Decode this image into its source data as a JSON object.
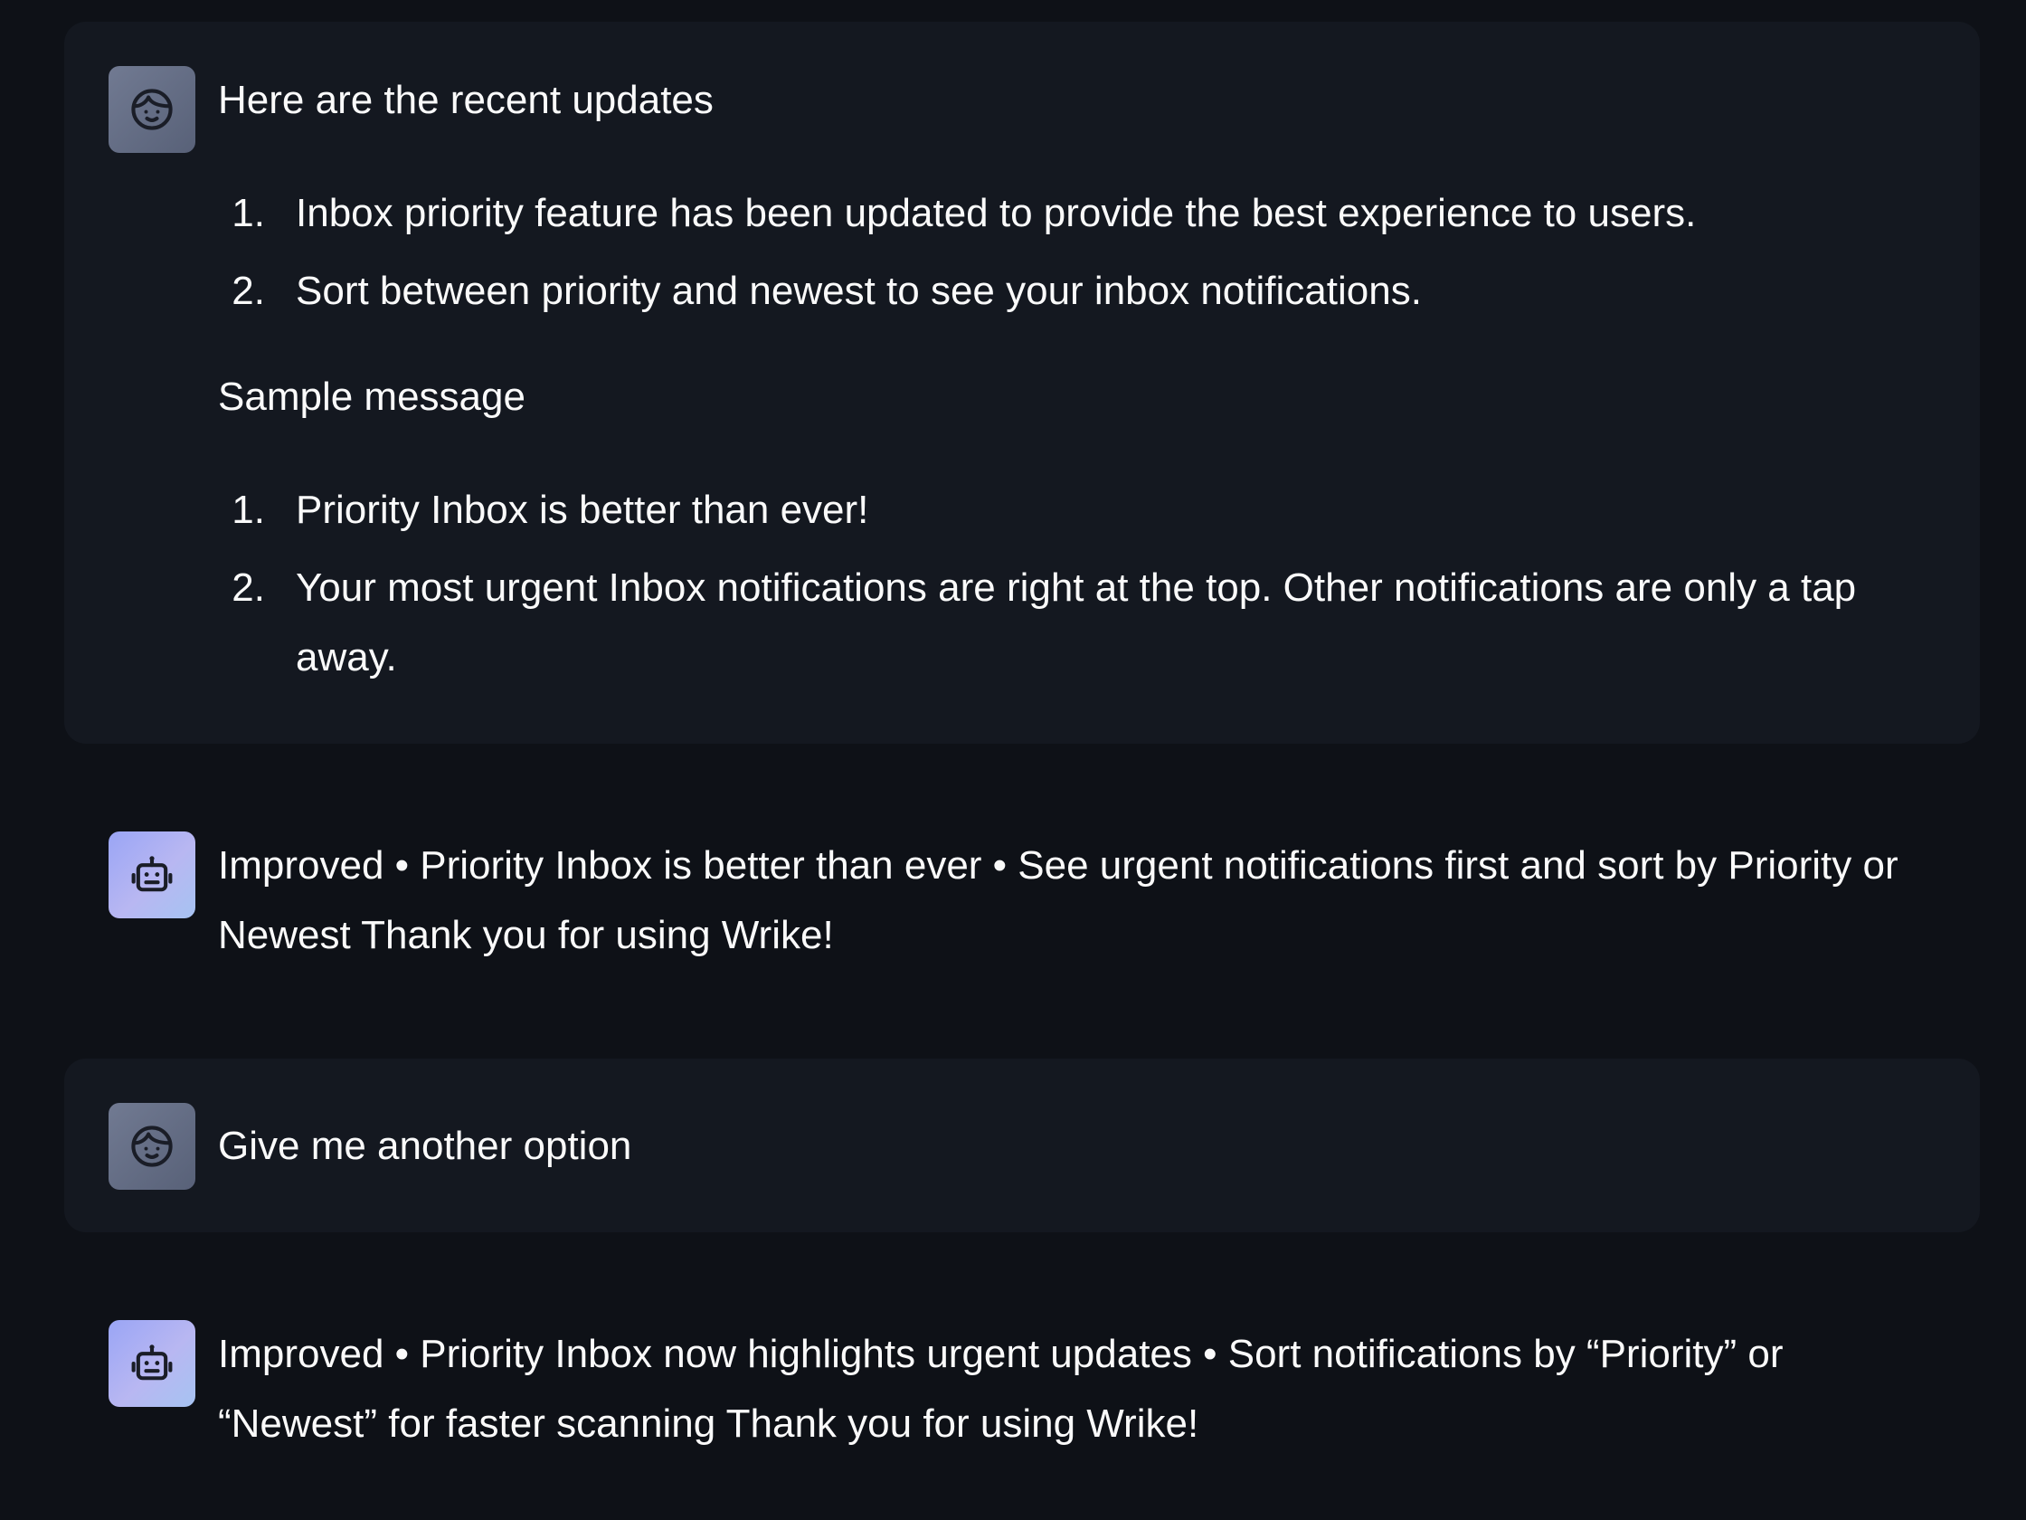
{
  "messages": [
    {
      "role": "user",
      "avatar_icon": "user-face-icon",
      "intro": "Here are the recent updates",
      "list1": [
        "Inbox priority feature has been updated to provide the best experience to users.",
        "Sort between priority and newest to see your inbox notifications."
      ],
      "subheading": "Sample message",
      "list2": [
        "Priority Inbox is better than ever!",
        "Your most urgent Inbox notifications are right at the top. Other notifications are only a tap away."
      ]
    },
    {
      "role": "assistant",
      "avatar_icon": "robot-icon",
      "text": "Improved • Priority Inbox is better than ever • See urgent notifications first and sort by Priority or Newest Thank you for using Wrike!"
    },
    {
      "role": "user",
      "avatar_icon": "user-face-icon",
      "text": "Give me another option"
    },
    {
      "role": "assistant",
      "avatar_icon": "robot-icon",
      "text": "Improved • Priority Inbox now highlights urgent updates • Sort notifications by “Priority” or “Newest” for faster scanning Thank you for using Wrike!"
    }
  ],
  "list_markers": [
    "1.",
    "2."
  ],
  "colors": {
    "page_bg": "#0e1117",
    "user_bubble_bg": "#141820",
    "text": "#fafafa",
    "user_avatar": "#6b7389",
    "bot_avatar": "#a9b2f4"
  }
}
